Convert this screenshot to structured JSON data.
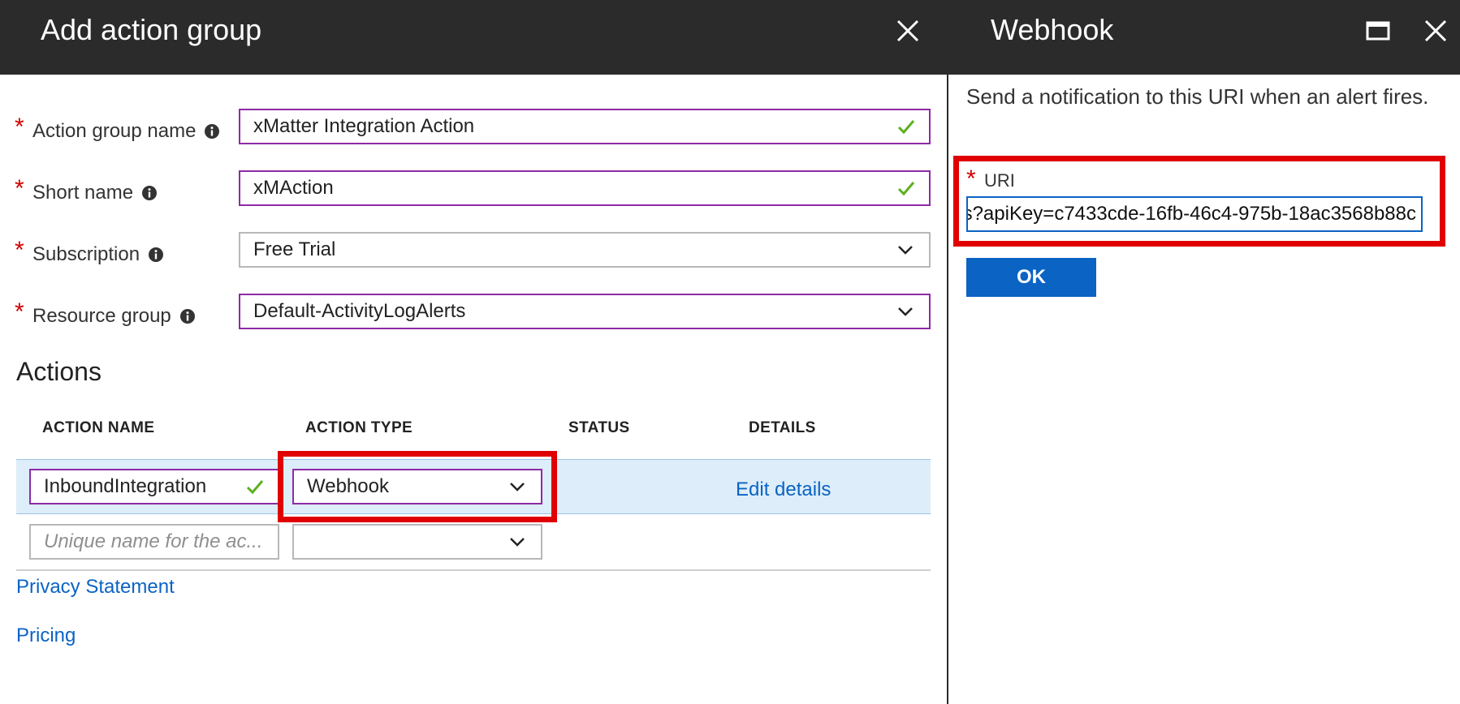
{
  "left_blade": {
    "title": "Add action group",
    "fields": {
      "action_group_name": {
        "label": "Action group name",
        "value": "xMatter Integration Action"
      },
      "short_name": {
        "label": "Short name",
        "value": "xMAction"
      },
      "subscription": {
        "label": "Subscription",
        "value": "Free Trial"
      },
      "resource_group": {
        "label": "Resource group",
        "value": "Default-ActivityLogAlerts"
      }
    },
    "actions": {
      "title": "Actions",
      "columns": [
        "ACTION NAME",
        "ACTION TYPE",
        "STATUS",
        "DETAILS"
      ],
      "rows": [
        {
          "name": "InboundIntegration",
          "type": "Webhook",
          "status": "",
          "details": "Edit details"
        }
      ],
      "new_row": {
        "name_placeholder": "Unique name for the ac...",
        "type": ""
      }
    },
    "links": {
      "privacy": "Privacy Statement",
      "pricing": "Pricing"
    }
  },
  "right_blade": {
    "title": "Webhook",
    "description": "Send a notification to this URI when an alert fires.",
    "uri_label": "URI",
    "uri_value": "s?apiKey=c7433cde-16fb-46c4-975b-18ac3568b88c",
    "ok_label": "OK"
  },
  "colors": {
    "header_bg": "#2b2b2b",
    "field_border_active": "#8e2aa6",
    "required_star": "#d40000",
    "link": "#0b63c4",
    "highlight_box": "#e00000",
    "selected_row": "#ddedf9",
    "valid_check": "#5cb020"
  },
  "icons": [
    "close-icon",
    "maximize-icon",
    "info-icon",
    "checkmark-icon",
    "chevron-down-icon"
  ]
}
